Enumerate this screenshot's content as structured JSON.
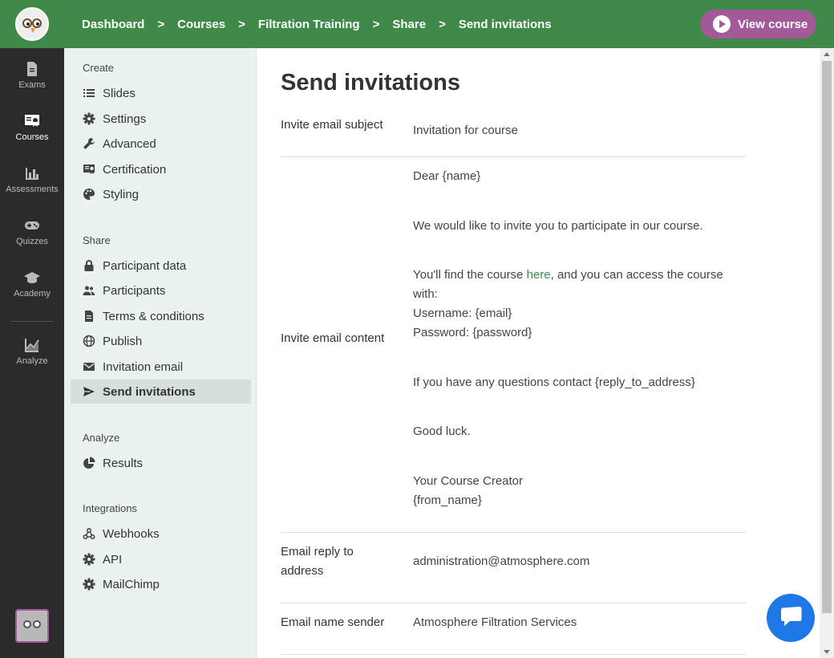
{
  "breadcrumbs": [
    "Dashboard",
    "Courses",
    "Filtration Training",
    "Share",
    "Send invitations"
  ],
  "breadcrumb_separator": ">",
  "view_course_label": "View course",
  "rail": {
    "items": [
      {
        "label": "Exams",
        "icon": "document-icon"
      },
      {
        "label": "Courses",
        "icon": "certificate-icon",
        "active": true
      },
      {
        "label": "Assessments",
        "icon": "bar-chart-icon"
      },
      {
        "label": "Quizzes",
        "icon": "gamepad-icon"
      },
      {
        "label": "Academy",
        "icon": "graduation-cap-icon"
      },
      {
        "label": "Analyze",
        "icon": "line-chart-icon"
      }
    ]
  },
  "sidemenu": {
    "create_heading": "Create",
    "create_items": [
      {
        "label": "Slides",
        "icon": "list-icon"
      },
      {
        "label": "Settings",
        "icon": "gear-icon"
      },
      {
        "label": "Advanced",
        "icon": "wrench-icon"
      },
      {
        "label": "Certification",
        "icon": "certificate-icon"
      },
      {
        "label": "Styling",
        "icon": "palette-icon"
      }
    ],
    "share_heading": "Share",
    "share_items": [
      {
        "label": "Participant data",
        "icon": "lock-icon"
      },
      {
        "label": "Participants",
        "icon": "people-icon"
      },
      {
        "label": "Terms & conditions",
        "icon": "document-icon"
      },
      {
        "label": "Publish",
        "icon": "globe-icon"
      },
      {
        "label": "Invitation email",
        "icon": "envelope-icon"
      },
      {
        "label": "Send invitations",
        "icon": "send-icon",
        "active": true
      }
    ],
    "analyze_heading": "Analyze",
    "analyze_items": [
      {
        "label": "Results",
        "icon": "pie-chart-icon"
      }
    ],
    "integrations_heading": "Integrations",
    "integrations_items": [
      {
        "label": "Webhooks",
        "icon": "webhook-icon"
      },
      {
        "label": "API",
        "icon": "gear-icon"
      },
      {
        "label": "MailChimp",
        "icon": "gear-icon"
      }
    ]
  },
  "main": {
    "title": "Send invitations",
    "subject_label": "Invite email subject",
    "subject_value": "Invitation for course",
    "content_label": "Invite email content",
    "content": {
      "greeting": "Dear {name}",
      "intro": "We would like to invite you to participate in our course.",
      "find_pre": "You'll find the course ",
      "find_link": "here",
      "find_post": ", and you can access the course",
      "find_with": "with:",
      "username": "Username: {email}",
      "password": "Password: {password}",
      "questions": "If you have any questions contact {reply_to_address}",
      "luck": "Good luck.",
      "sign1": "Your Course Creator",
      "sign2": "{from_name}"
    },
    "reply_label_1": "Email reply to",
    "reply_label_2": "address",
    "reply_value": "administration@atmosphere.com",
    "sender_label": "Email name sender",
    "sender_value": "Atmosphere Filtration Services"
  },
  "colors": {
    "brand_green": "#3f8a48",
    "accent_purple": "#a35a99",
    "rail_bg": "#2b2b2b",
    "menu_bg": "#eaf3ee",
    "chat_blue": "#1e78e6"
  }
}
